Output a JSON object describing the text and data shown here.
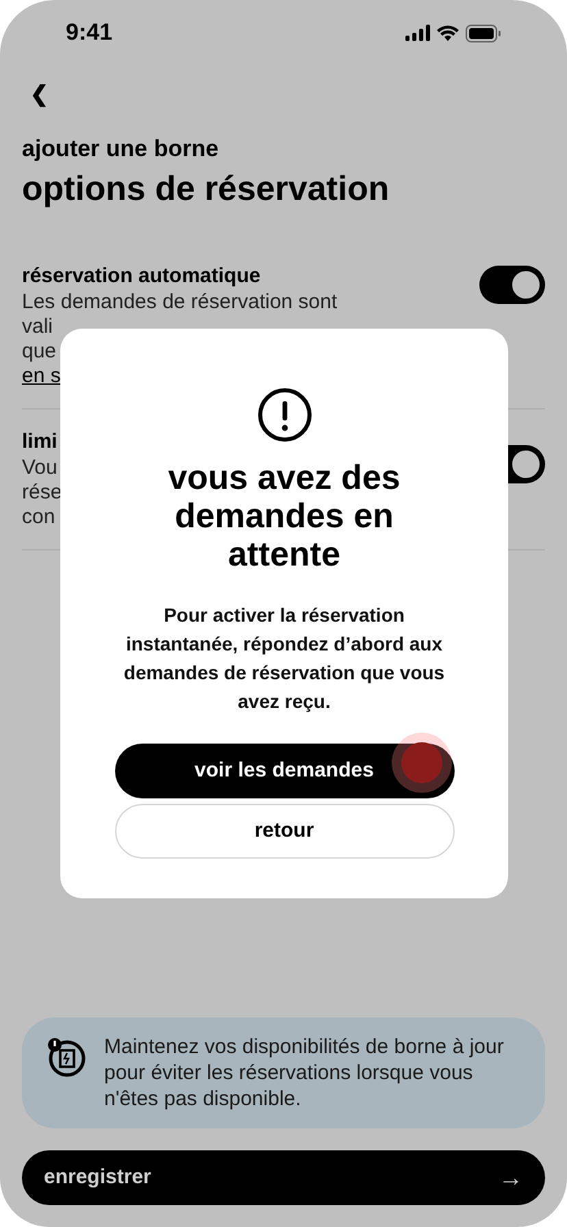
{
  "status_bar": {
    "time": "9:41"
  },
  "header": {
    "back": "❮",
    "subtitle": "ajouter une borne",
    "title": "options de réservation"
  },
  "options": [
    {
      "title": "réservation automatique",
      "lines": [
        "Les demandes de réservation sont",
        "vali",
        "que"
      ],
      "link": "en s",
      "on": true
    },
    {
      "title": "limi",
      "lines": [
        "Vou",
        "rése",
        "con"
      ],
      "on": true
    }
  ],
  "dialog": {
    "title": "vous avez des demandes en attente",
    "message": "Pour activer la réservation instantanée, répondez d’abord aux demandes de réservation que vous avez reçu.",
    "primary": "voir les demandes",
    "secondary": "retour"
  },
  "info": {
    "text": "Maintenez vos disponibilités de borne à jour pour éviter les réservations lorsque vous n'êtes pas disponible."
  },
  "save_button": {
    "label": "enregistrer",
    "arrow": "→"
  }
}
